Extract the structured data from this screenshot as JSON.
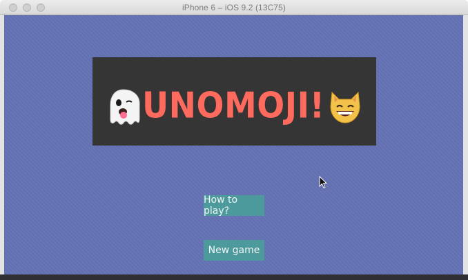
{
  "window": {
    "title": "iPhone 6 – iOS 9.2 (13C75)"
  },
  "app": {
    "logo_text": "UNOMOJI!",
    "logo_left_emoji": "ghost-emoji",
    "logo_right_emoji": "smiling-cat-emoji",
    "background_color": "#6472b4",
    "accent_color": "#ff6a5f"
  },
  "menu": {
    "how_to_play_label": "How to play?",
    "new_game_label": "New game",
    "button_color": "#4d9a9c"
  }
}
